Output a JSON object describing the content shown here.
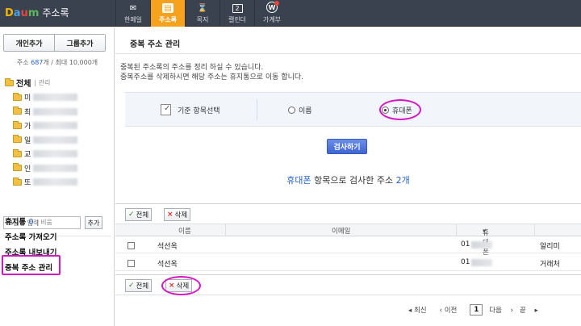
{
  "topbar": {
    "logo": {
      "d": "D",
      "a": "a",
      "u": "u",
      "m": "m"
    },
    "app_title": "주소록",
    "nav": [
      {
        "label": "한메일",
        "icon": "mail-icon"
      },
      {
        "label": "주소록",
        "icon": "address-book-icon",
        "active": true
      },
      {
        "label": "목지",
        "icon": "hourglass-icon"
      },
      {
        "label": "캘린더",
        "icon": "calendar-icon",
        "badge": "2"
      },
      {
        "label": "가계부",
        "icon": "wallet-icon",
        "badge": "W"
      }
    ]
  },
  "sidebar": {
    "add_person": "개인추가",
    "add_group": "그룹추가",
    "count_prefix": "주소 ",
    "count_value": "687",
    "count_suffix": "개 / 최대 10,000개",
    "tree_title": "전체",
    "tree_manage": "관리",
    "tree_items": [
      "미",
      "최",
      "가",
      "일",
      "교",
      "인",
      "또"
    ],
    "group_input_placeholder": "그룹명 입력",
    "add_button": "추가",
    "trash_label": "휴지통",
    "trash_count": "0",
    "trash_empty": "비움",
    "import_label": "주소록 가져오기",
    "export_label": "주소록 내보내기",
    "duplicate_label": "중복 주소 관리"
  },
  "main": {
    "title": "중복 주소 관리",
    "desc_line1": "중복된 주소록의 주소를 정리 하실 수 있습니다.",
    "desc_line2": "중복주소를 삭제하시면 해당 주소는 휴지통으로 이동 합니다.",
    "filter_label": "기준 항목선택",
    "option_name": "이름",
    "option_phone": "휴대폰",
    "search_button": "검사하기",
    "result_field": "휴대폰",
    "result_text": " 항목으로 검사한 주소 ",
    "result_count": "2개",
    "select_all": "전체",
    "delete": "삭제",
    "col_name": "이름",
    "col_email": "이메일",
    "col_phone": "휴대폰",
    "rows": [
      {
        "name": "석선옥",
        "phone_prefix": "01",
        "group": "알리미"
      },
      {
        "name": "석선옥",
        "phone_prefix": "01",
        "group": "거래처"
      }
    ],
    "pager": {
      "first": "최신",
      "prev": "이전",
      "current": "1",
      "next": "다음",
      "last": "끝"
    }
  }
}
